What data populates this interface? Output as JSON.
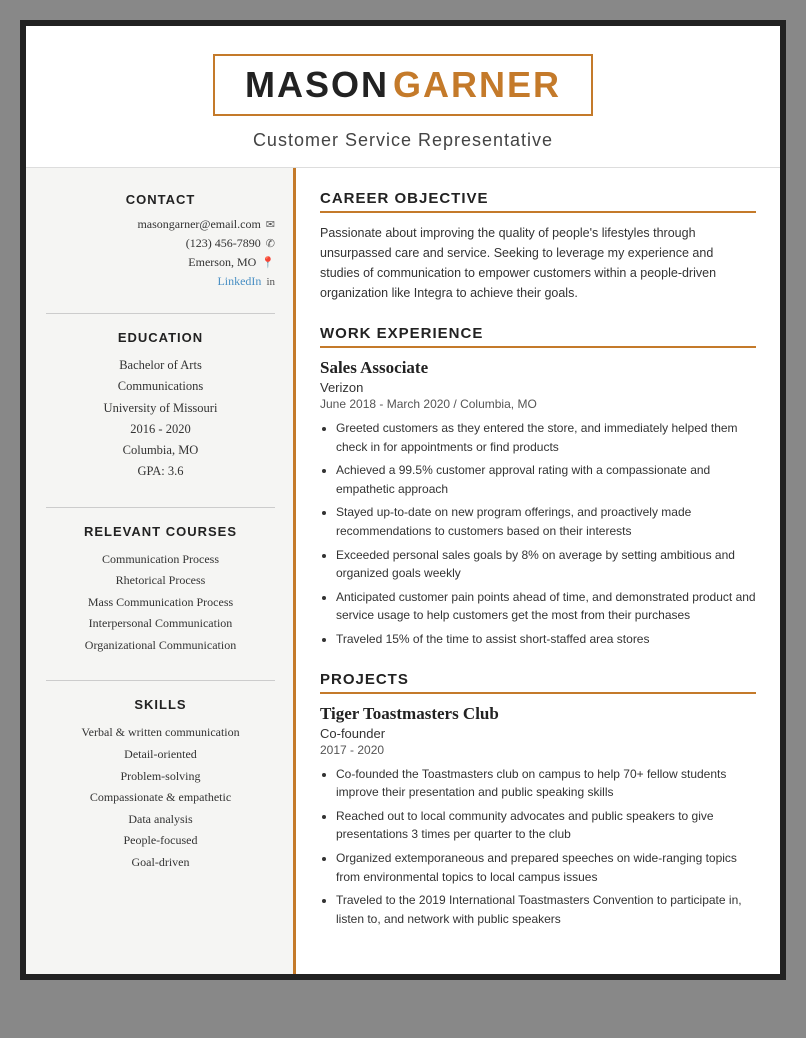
{
  "header": {
    "first_name": "MASON",
    "last_name": "GARNER",
    "job_title": "Customer Service Representative"
  },
  "sidebar": {
    "contact_title": "CONTACT",
    "contact": {
      "email": "masongarner@email.com",
      "phone": "(123) 456-7890",
      "location": "Emerson, MO",
      "linkedin_text": "LinkedIn"
    },
    "education_title": "EDUCATION",
    "education": {
      "degree": "Bachelor of Arts",
      "field": "Communications",
      "university": "University of Missouri",
      "years": "2016 - 2020",
      "location": "Columbia, MO",
      "gpa": "GPA: 3.6"
    },
    "courses_title": "RELEVANT COURSES",
    "courses": [
      "Communication Process",
      "Rhetorical Process",
      "Mass Communication Process",
      "Interpersonal Communication",
      "Organizational Communication"
    ],
    "skills_title": "SKILLS",
    "skills": [
      "Verbal & written communication",
      "Detail-oriented",
      "Problem-solving",
      "Compassionate & empathetic",
      "Data analysis",
      "People-focused",
      "Goal-driven"
    ]
  },
  "main": {
    "career_objective_title": "CAREER OBJECTIVE",
    "career_objective_text": "Passionate about improving the quality of people's lifestyles through unsurpassed care and service. Seeking to leverage my experience and studies of communication to empower customers within a people-driven organization like Integra to achieve their goals.",
    "work_experience_title": "WORK EXPERIENCE",
    "jobs": [
      {
        "title": "Sales Associate",
        "company": "Verizon",
        "meta": "June 2018 - March 2020  /  Columbia, MO",
        "bullets": [
          "Greeted customers as they entered the store, and immediately helped them check in for appointments or find products",
          "Achieved a 99.5% customer approval rating with a compassionate and empathetic approach",
          "Stayed up-to-date on new program offerings, and proactively made recommendations to customers based on their interests",
          "Exceeded personal sales goals by 8% on average by setting ambitious and organized goals weekly",
          "Anticipated customer pain points ahead of time, and demonstrated product and service usage to help customers get the most from their purchases",
          "Traveled 15% of the time to assist short-staffed area stores"
        ]
      }
    ],
    "projects_title": "PROJECTS",
    "projects": [
      {
        "name": "Tiger Toastmasters Club",
        "role": "Co-founder",
        "years": "2017 - 2020",
        "bullets": [
          "Co-founded the Toastmasters club on campus to help 70+ fellow students improve their presentation and public speaking skills",
          "Reached out to local community advocates and public speakers to give presentations 3 times per quarter to the club",
          "Organized extemporaneous and prepared speeches on wide-ranging topics from environmental topics to local campus issues",
          "Traveled to the 2019 International Toastmasters Convention to participate in, listen to, and network with public speakers"
        ]
      }
    ]
  }
}
